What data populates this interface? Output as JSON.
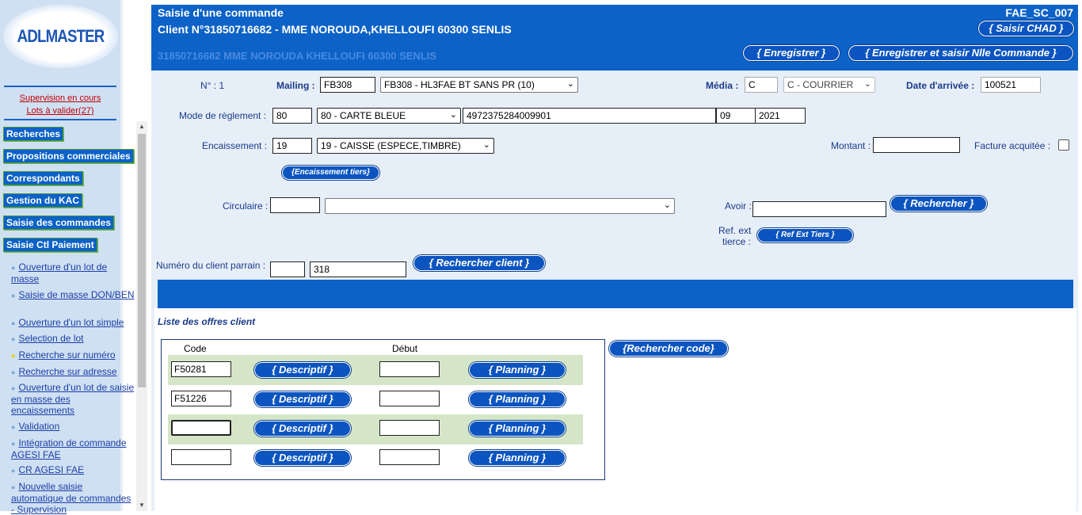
{
  "sidebar": {
    "logo_text": "ADLMASTER",
    "supervision": "Supervision en cours",
    "lots": "Lots à valider(27)",
    "buttons": [
      "Recherches",
      "Propositions commerciales",
      "Correspondants",
      "Gestion du KAC",
      "Saisie des commandes",
      "Saisie Ctl Paiement"
    ],
    "links": [
      "Ouverture d'un lot de masse",
      "Saisie de masse DON/BEN",
      "Ouverture d'un lot simple",
      "Selection de lot",
      "Recherche sur numéro",
      "Recherche sur adresse",
      "Ouverture d'un lot de saisie en masse des encaissements",
      "Validation",
      "Intégration de commande AGESI FAE",
      "CR AGESI FAE",
      "Nouvelle saisie automatique de commandes - Supervision"
    ]
  },
  "header": {
    "title": "Saisie d'une commande",
    "client": "Client N°31850716682 - MME NOROUDA,KHELLOUFI 60300 SENLIS",
    "code": "FAE_SC_007",
    "ghost": "31850716682 MME NOROUDA KHELLOUFI 60300 SENLIS",
    "btn_chad": "{ Saisir CHAD }",
    "btn_save": "{ Enregistrer }",
    "btn_save_new": "{ Enregistrer et saisir Nlle Commande }"
  },
  "form": {
    "num_label": "N° : 1",
    "mailing_label": "Mailing :",
    "mailing_code": "FB308",
    "mailing_select": "FB308 - HL3FAE BT SANS PR (10)",
    "media_label": "Média :",
    "media_code": "C",
    "media_select": "C - COURRIER",
    "date_label": "Date d'arrivée :",
    "date_value": "100521",
    "reglement_label": "Mode de règlement :",
    "reglement_code": "80",
    "reglement_select": "80 - CARTE BLEUE",
    "card_number": "4972375284009901",
    "card_month": "09",
    "card_year": "2021",
    "encaissement_label": "Encaissement :",
    "encaissement_code": "19",
    "encaissement_select": "19 - CAISSE (ESPECE,TIMBRE)",
    "montant_label": "Montant :",
    "montant_value": "",
    "facture_label": "Facture acquitée :",
    "btn_encaissement_tiers": "{Encaissement tiers}",
    "circulaire_label": "Circulaire :",
    "circulaire_code": "",
    "circulaire_select": "",
    "avoir_label": "Avoir :",
    "avoir_value": "",
    "btn_rechercher": "{ Rechercher }",
    "refext_label_1": "Ref. ext",
    "refext_label_2": "tierce :",
    "btn_refext": "{ Ref Ext Tiers }",
    "parrain_label": "Numéro du client parrain :",
    "parrain_code": "",
    "parrain_value": "318",
    "btn_rechercher_client": "{ Rechercher client }"
  },
  "offers": {
    "title": "Liste des offres client",
    "col_code": "Code",
    "col_debut": "Début",
    "btn_rechercher_code": "{Rechercher code}",
    "btn_descriptif": "{ Descriptif }",
    "btn_planning": "{ Planning }",
    "rows": [
      {
        "code": "F50281",
        "debut": ""
      },
      {
        "code": "F51226",
        "debut": ""
      },
      {
        "code": "",
        "debut": ""
      },
      {
        "code": "",
        "debut": ""
      }
    ]
  }
}
